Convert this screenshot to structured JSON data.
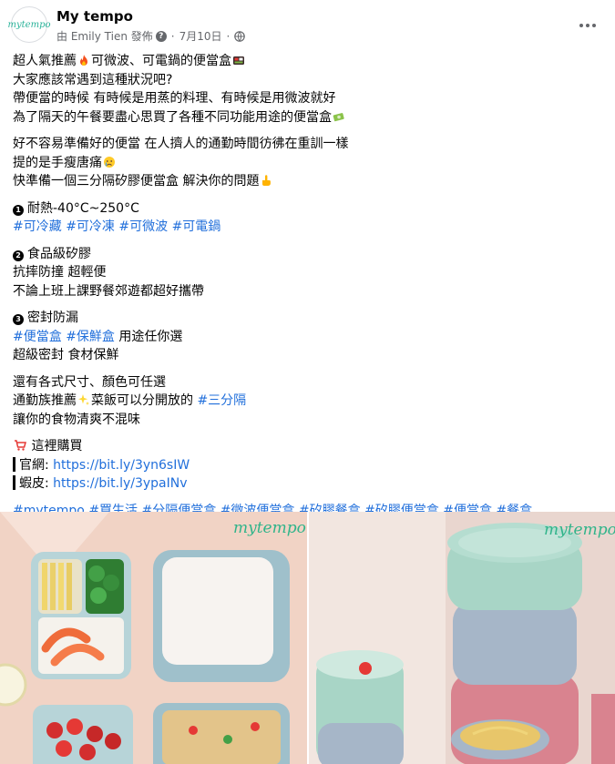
{
  "header": {
    "avatar_text": "mytempo",
    "page_name": "My tempo",
    "posted_by": "由 Emily Tien 發佈",
    "date": "7月10日",
    "help_symbol": "?"
  },
  "post": {
    "lines": [
      "超人氣推薦",
      "可微波、可電鍋的便當盒",
      "大家應該常遇到這種狀況吧?",
      "帶便當的時候 有時候是用蒸的料理、有時候是用微波就好",
      "為了隔天的午餐要盡心思買了各種不同功能用途的便當盒",
      "好不容易準備好的便當 在人擠人的通勤時間彷彿在重訓一樣",
      "提的是手瘦唐痛",
      "快準備一個三分隔矽膠便當盒 解決你的問題",
      "耐熱-40°C~250°C",
      "食品級矽膠",
      "抗摔防撞 超輕便",
      "不論上班上課野餐郊遊都超好攜帶",
      "密封防漏",
      "用途任你選",
      "超級密封 食材保鮮",
      "還有各式尺寸、顏色可任選",
      "通勤族推薦",
      "菜飯可以分開放的",
      "讓你的食物清爽不混味",
      "這裡購買",
      "官網: ",
      "蝦皮: "
    ],
    "tags_block1": [
      "#可冷藏",
      "#可冷凍",
      "#可微波",
      "#可電鍋"
    ],
    "tags_block3": [
      "#便當盒",
      "#保鮮盒"
    ],
    "tag_inline": "#三分隔",
    "bullets": [
      "❶",
      "❷",
      "❸"
    ],
    "link_official": "https://bit.ly/3yn6sIW",
    "link_shopee": "https://bit.ly/3ypaINv",
    "hashtags": [
      "#mytempo",
      "#買生活",
      "#分隔便當盒",
      "#微波便當盒",
      "#矽膠餐盒",
      "#矽膠便當盒",
      "#便當盒",
      "#餐盒"
    ]
  },
  "photos": {
    "left_watermark": "mytempo",
    "right_watermark": "mytempo"
  },
  "colors": {
    "link": "#216fdb",
    "text": "#050505",
    "meta": "#65676b",
    "brand_green": "#2fb48a"
  }
}
